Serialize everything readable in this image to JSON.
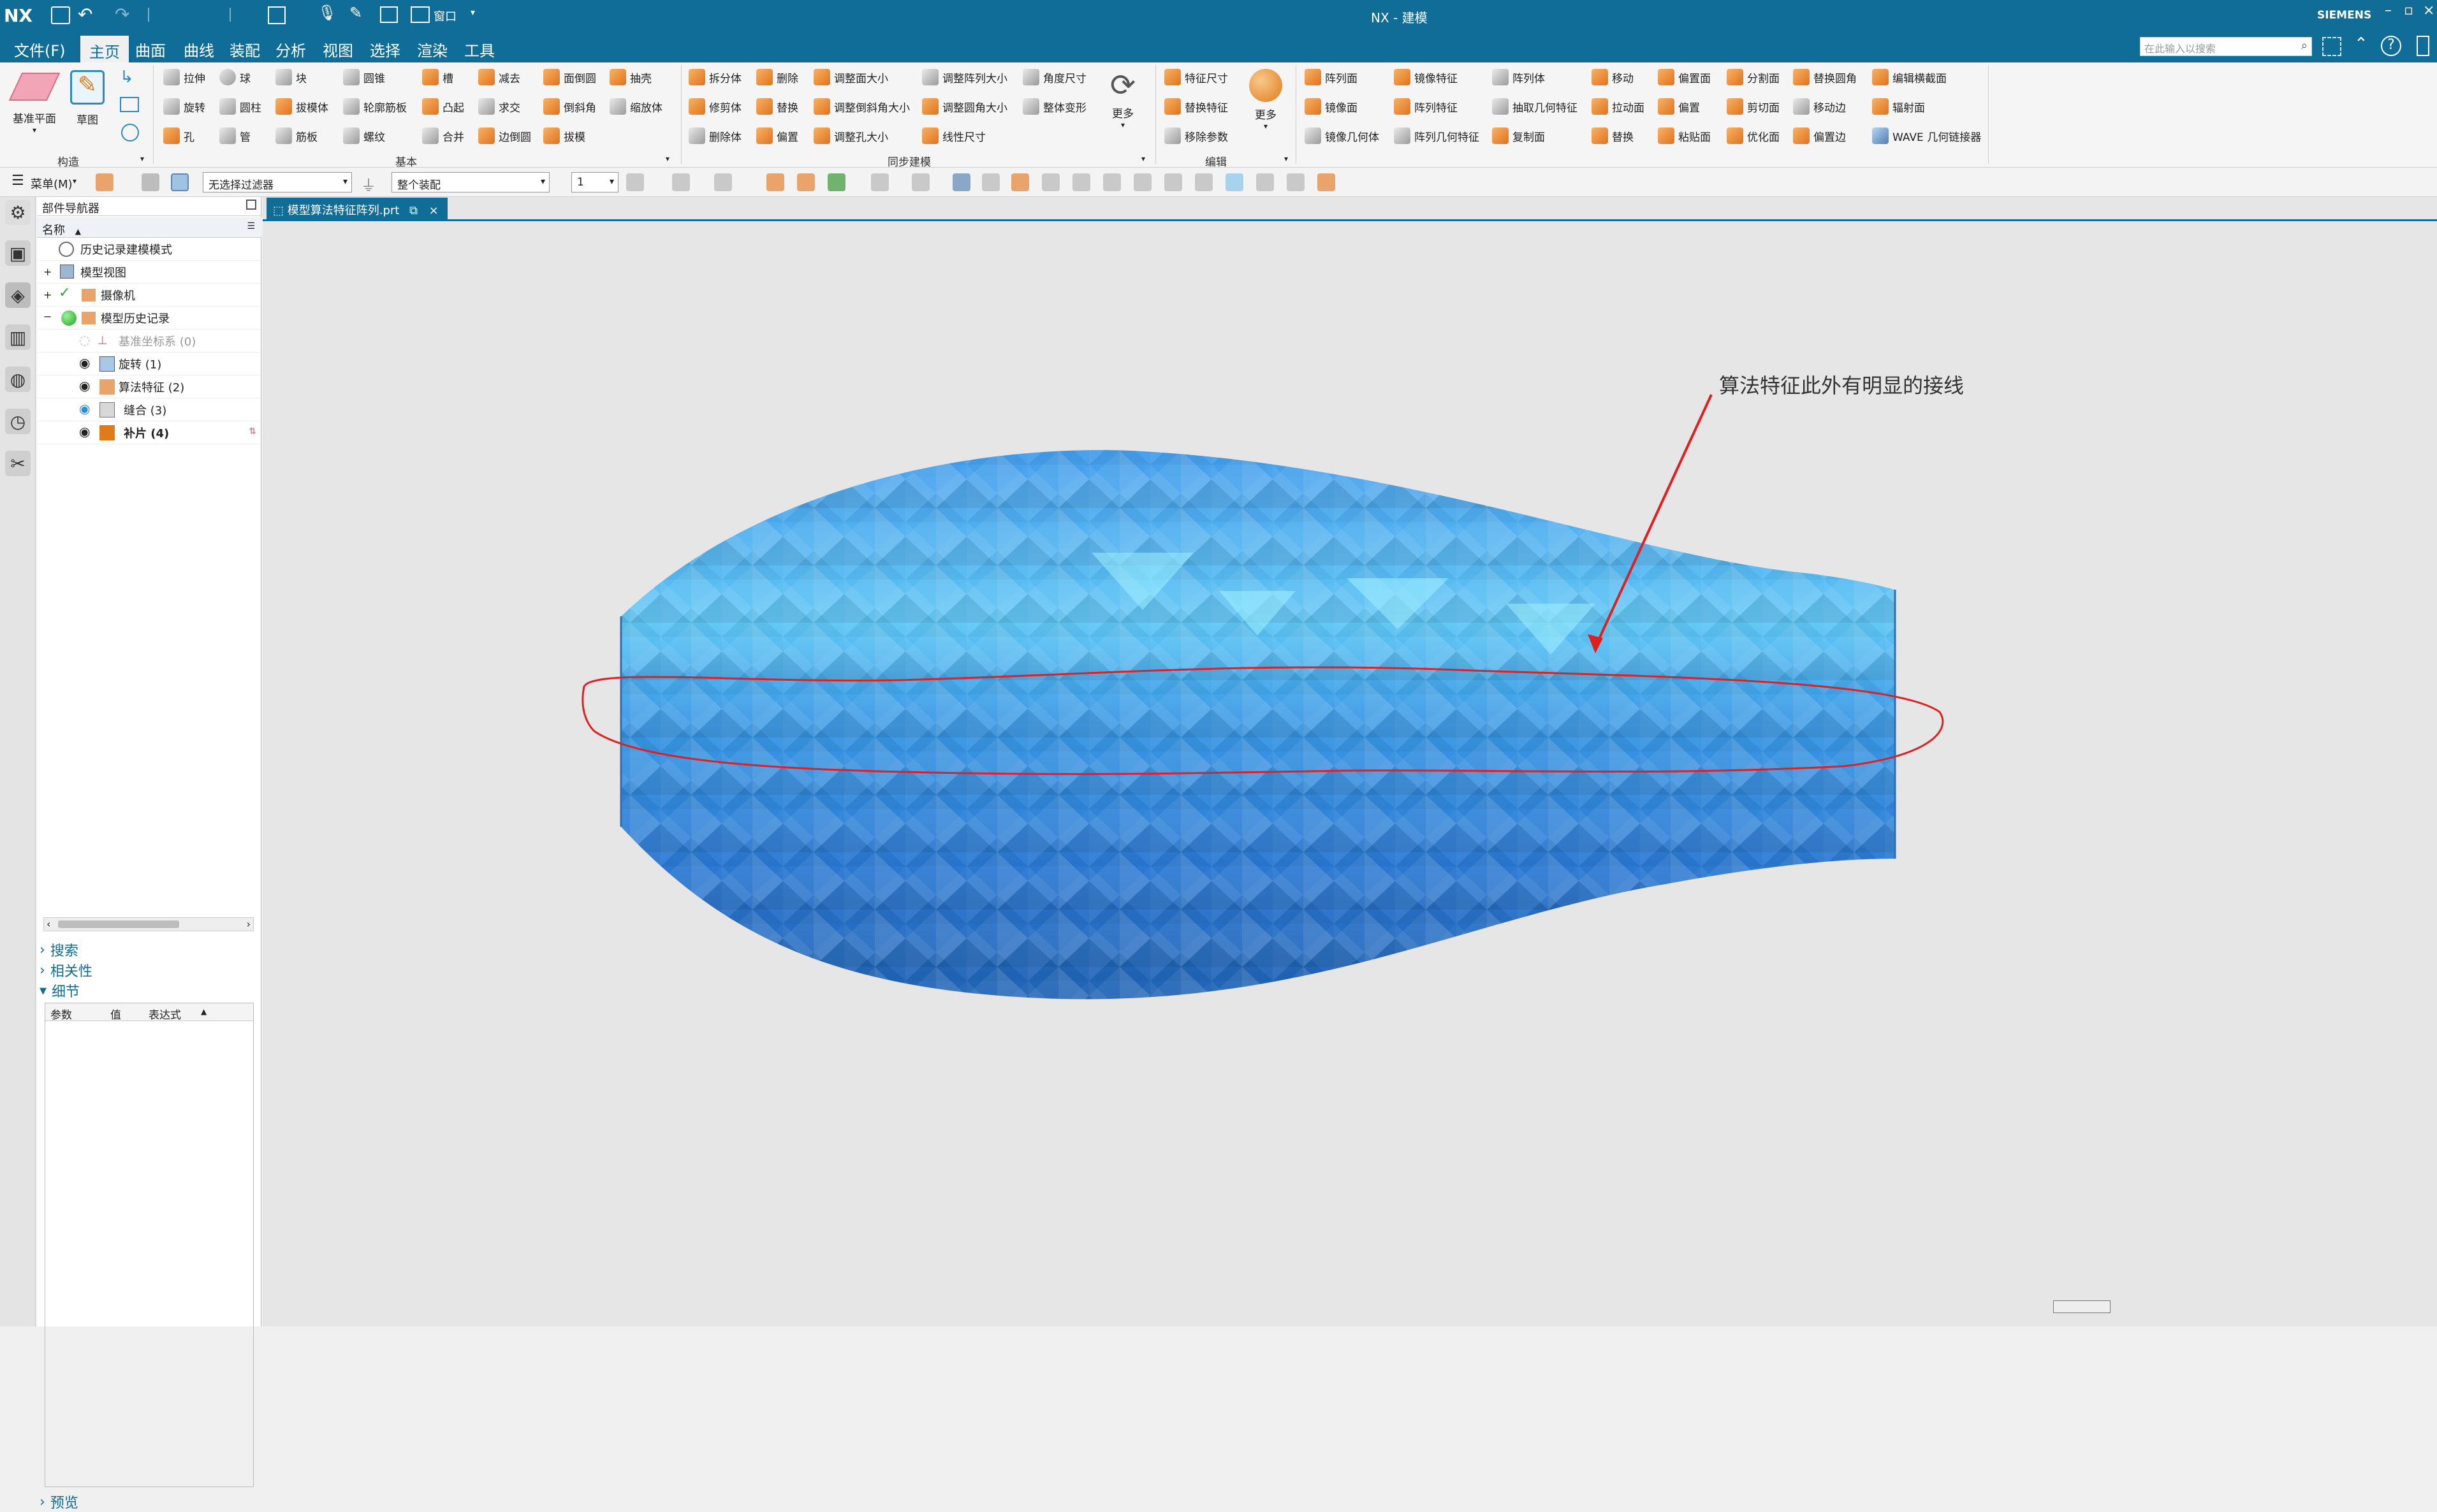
{
  "title_bar": {
    "logo": "NX",
    "title": "NX - 建模",
    "window_menu": "窗口",
    "brand": "SIEMENS",
    "search_placeholder": "在此输入以搜索"
  },
  "menu": {
    "file": "文件(F)",
    "tabs": [
      "主页",
      "曲面",
      "曲线",
      "装配",
      "分析",
      "视图",
      "选择",
      "渲染",
      "工具"
    ],
    "active": "主页"
  },
  "ribbon": {
    "large": {
      "datum_plane": "基准平面",
      "sketch": "草图",
      "more1": "更多",
      "more2": "更多"
    },
    "groups": {
      "construct": "构造",
      "basic": "基本",
      "sync": "同步建模",
      "edit": "编辑"
    },
    "col1": [
      "拉伸",
      "旋转",
      "孔"
    ],
    "col2": [
      "球",
      "圆柱",
      "管"
    ],
    "col3": [
      "块",
      "拔模体",
      "筋板"
    ],
    "col4": [
      "圆锥",
      "轮廓筋板",
      "螺纹"
    ],
    "col5": [
      "槽",
      "凸起",
      "合并"
    ],
    "col6": [
      "减去",
      "求交",
      "边倒圆"
    ],
    "col7": [
      "面倒圆",
      "倒斜角",
      "拔模"
    ],
    "col8": [
      "抽壳",
      "缩放体"
    ],
    "col9": [
      "拆分体",
      "修剪体",
      "删除体"
    ],
    "col10": [
      "删除",
      "替换",
      "偏置"
    ],
    "col11": [
      "调整面大小",
      "调整倒斜角大小",
      "调整孔大小"
    ],
    "col12": [
      "调整阵列大小",
      "调整圆角大小",
      "线性尺寸"
    ],
    "col13": [
      "角度尺寸",
      "整体变形"
    ],
    "col14": [
      "特征尺寸",
      "替换特征",
      "移除参数"
    ],
    "col15": [
      "阵列面",
      "镜像面",
      "镜像几何体"
    ],
    "col16": [
      "镜像特征",
      "阵列特征",
      "阵列几何特征"
    ],
    "col17": [
      "阵列体",
      "抽取几何特征",
      "复制面"
    ],
    "col18": [
      "移动",
      "拉动面",
      "替换"
    ],
    "col19": [
      "偏置面",
      "偏置",
      "粘贴面"
    ],
    "col20": [
      "分割面",
      "剪切面",
      "优化面"
    ],
    "col21": [
      "替换圆角",
      "移动边",
      "偏置边"
    ],
    "col22": [
      "编辑横截面",
      "辐射面",
      "WAVE 几何链接器"
    ]
  },
  "toolbar2": {
    "menu": "菜单(M)",
    "filter": "无选择过滤器",
    "scope": "整个装配",
    "layer": "1"
  },
  "navigator": {
    "title": "部件导航器",
    "col_name": "名称",
    "rows": [
      {
        "label": "历史记录建模模式"
      },
      {
        "label": "模型视图"
      },
      {
        "label": "摄像机"
      },
      {
        "label": "模型历史记录"
      },
      {
        "label": "基准坐标系 (0)"
      },
      {
        "label": "旋转 (1)"
      },
      {
        "label": "算法特征 (2)"
      },
      {
        "label": "缝合 (3)"
      },
      {
        "label": "补片 (4)"
      }
    ],
    "search": "搜索",
    "relevance": "相关性",
    "detail": "细节",
    "detail_cols": [
      "参数",
      "值",
      "表达式"
    ],
    "preview": "预览"
  },
  "document_tab": {
    "name": "模型算法特征阵列.prt"
  },
  "annotation": {
    "text": "算法特征此外有明显的接线",
    "color": "#e02020"
  },
  "colors": {
    "accent": "#0f6d97",
    "model_light": "#7fe0ff",
    "model_dark": "#1e5fa8"
  }
}
